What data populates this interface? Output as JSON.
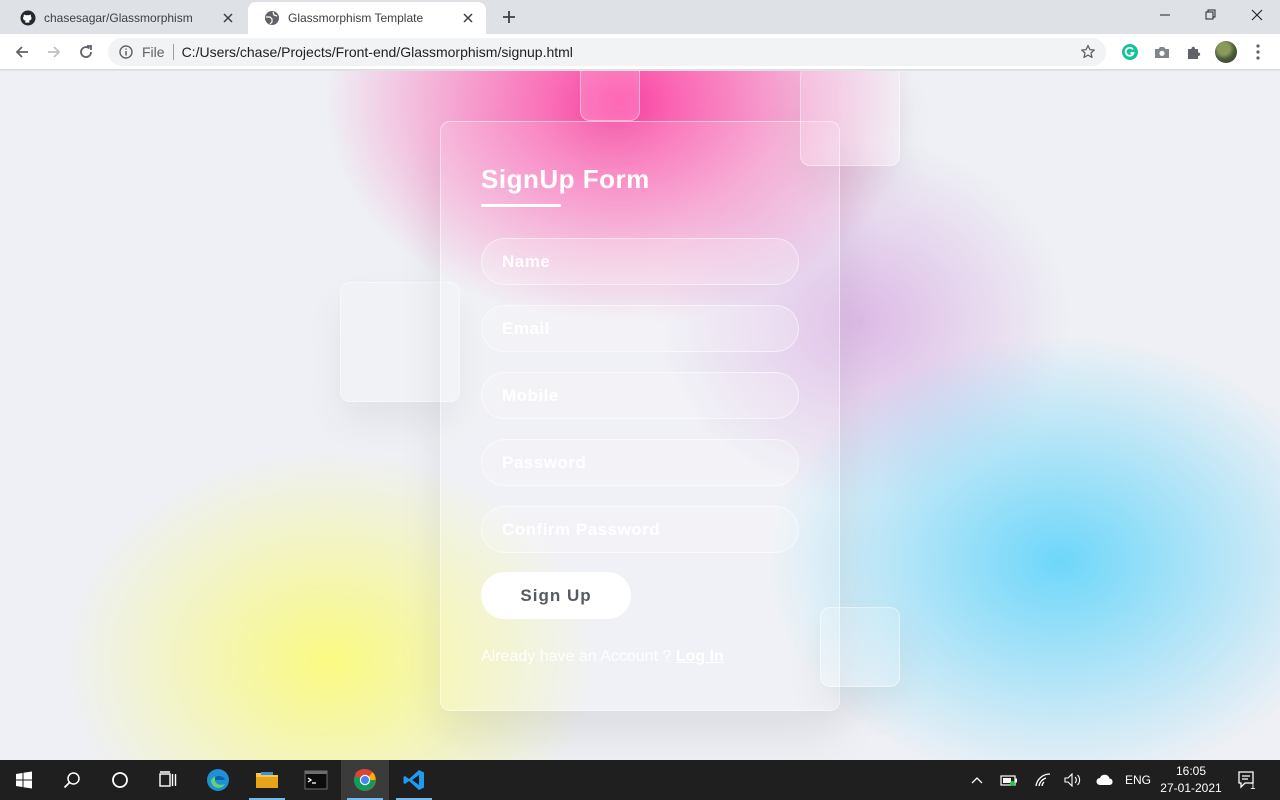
{
  "browser": {
    "tabs": [
      {
        "title": "chasesagar/Glassmorphism",
        "icon": "github-icon",
        "active": false
      },
      {
        "title": "Glassmorphism Template",
        "icon": "globe-icon",
        "active": true
      }
    ],
    "address_bar": {
      "scheme_label": "File",
      "url": "C:/Users/chase/Projects/Front-end/Glassmorphism/signup.html"
    }
  },
  "page": {
    "form": {
      "title": "SignUp Form",
      "fields": [
        {
          "placeholder": "Name"
        },
        {
          "placeholder": "Email"
        },
        {
          "placeholder": "Mobile"
        },
        {
          "placeholder": "Password"
        },
        {
          "placeholder": "Confirm Password"
        }
      ],
      "submit_label": "Sign Up",
      "login_prompt": "Already have an Account ?",
      "login_link": "Log In"
    },
    "colors": {
      "pink": "#ff3ca0",
      "yellow": "#fafa82",
      "cyan": "#6ed7fa"
    }
  },
  "taskbar": {
    "language": "ENG",
    "time": "16:05",
    "date": "27-01-2021",
    "notification_count": "1"
  }
}
